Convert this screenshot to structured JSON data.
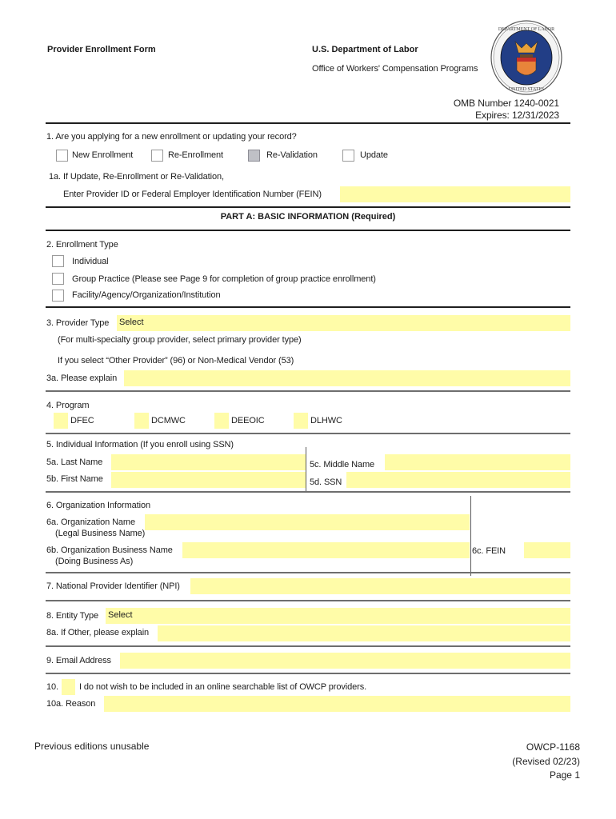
{
  "header": {
    "form_title": "Provider Enrollment Form",
    "agency": "U.S. Department of Labor",
    "office": "Office of Workers' Compensation Programs",
    "seal_icon": "department-of-labor-seal",
    "omb_number": "OMB Number 1240-0021",
    "expires": "Expires: 12/31/2023"
  },
  "q1": {
    "label": "1. Are you applying for a new enrollment or updating your record?",
    "options": [
      {
        "label": "New Enrollment",
        "checked": false,
        "focused": false
      },
      {
        "label": "Re-Enrollment",
        "checked": false,
        "focused": false
      },
      {
        "label": "Re-Validation",
        "checked": false,
        "focused": true
      },
      {
        "label": "Update",
        "checked": false,
        "focused": false
      }
    ],
    "q1a_label_line1": "1a. If Update, Re-Enrollment or Re-Validation,",
    "q1a_label_line2": "Enter Provider ID or Federal Employer Identification Number (FEIN)",
    "q1a_value": ""
  },
  "part_a": {
    "title": "PART A: BASIC INFORMATION (Required)"
  },
  "q2": {
    "label": "2. Enrollment Type",
    "options": [
      {
        "label": "Individual",
        "checked": false
      },
      {
        "label": "Group Practice (Please see Page 9 for completion of group practice enrollment)",
        "checked": false
      },
      {
        "label": "Facility/Agency/Organization/Institution",
        "checked": false
      }
    ]
  },
  "q3": {
    "label": "3. Provider Type",
    "value": "Select",
    "note1": "(For multi-specialty group provider, select primary provider type)",
    "note2": "If you select “Other Provider” (96) or Non-Medical Vendor (53)",
    "q3a_label": "3a. Please explain",
    "q3a_value": ""
  },
  "q4": {
    "label": "4. Program",
    "options": [
      {
        "label": "DFEC",
        "checked": false
      },
      {
        "label": "DCMWC",
        "checked": false
      },
      {
        "label": "DEEOIC",
        "checked": false
      },
      {
        "label": "DLHWC",
        "checked": false
      }
    ]
  },
  "q5": {
    "label": "5. Individual Information (If you enroll using SSN)",
    "last_name_label": "5a. Last Name",
    "last_name_value": "",
    "first_name_label": "5b. First Name",
    "first_name_value": "",
    "middle_name_label": "5c. Middle  Name",
    "middle_name_value": "",
    "ssn_label": "5d. SSN",
    "ssn_value": ""
  },
  "q6": {
    "label": "6. Organization Information",
    "org_name_label": "6a. Organization Name",
    "org_name_sub": "(Legal Business Name)",
    "org_name_value": "",
    "business_name_label": "6b. Organization Business Name",
    "business_name_sub": "(Doing Business As)",
    "business_name_value": "",
    "fein_label": "6c. FEIN",
    "fein_value": ""
  },
  "q7": {
    "label": "7. National Provider Identifier (NPI)",
    "value": ""
  },
  "q8": {
    "label": "8. Entity Type",
    "value": "Select",
    "q8a_label": "8a. If Other, please explain",
    "q8a_value": ""
  },
  "q9": {
    "label": "9. Email Address",
    "value": ""
  },
  "q10": {
    "number": "10.",
    "checked": false,
    "text": "I do not wish to be included in an online searchable list of OWCP providers.",
    "q10a_label": "10a. Reason",
    "q10a_value": ""
  },
  "footer": {
    "left": "Previous editions unusable",
    "form_number": "OWCP-1168",
    "revised": "(Revised 02/23)",
    "page": "Page 1"
  },
  "colors": {
    "field_fill": "#fffca8",
    "focused_checkbox": "#bfc0c6",
    "rule_dark": "#1e1e1e",
    "rule_gray": "#6e6e6e"
  }
}
